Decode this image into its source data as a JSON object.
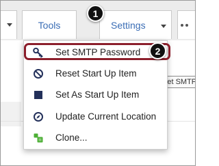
{
  "toolbar": {
    "tools_label": "Tools",
    "settings_label": "Settings"
  },
  "menu": {
    "items": [
      {
        "label": "Set SMTP Password",
        "icon": "key-icon"
      },
      {
        "label": "Reset Start Up Item",
        "icon": "no-entry-icon"
      },
      {
        "label": "Set As Start Up Item",
        "icon": "square-icon"
      },
      {
        "label": "Update Current Location",
        "icon": "compass-icon"
      },
      {
        "label": "Clone...",
        "icon": "clone-icon"
      }
    ]
  },
  "tooltip": {
    "text": "Set SMTP"
  },
  "steps": {
    "one": "1",
    "two": "2"
  },
  "colors": {
    "link_blue": "#3a6db5",
    "icon_navy": "#23305a",
    "highlight_red": "#8b1e2b",
    "clone_green": "#4caf35"
  }
}
